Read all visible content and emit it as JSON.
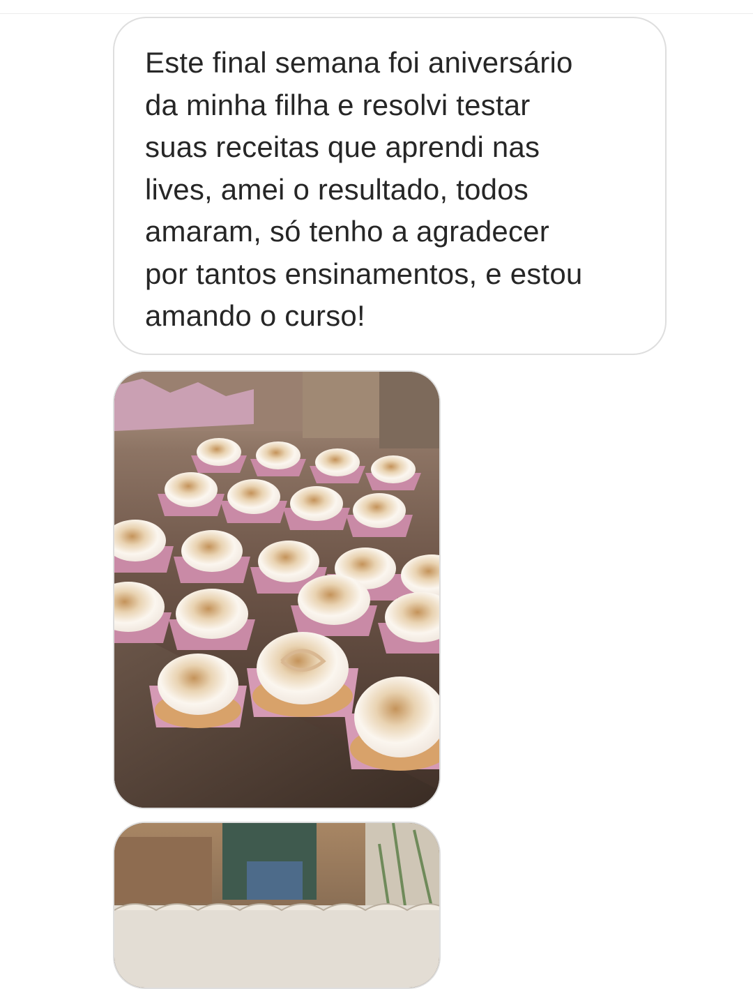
{
  "thread": {
    "messages": [
      {
        "type": "text",
        "text": "Este final semana foi aniversário\nda minha filha e resolvi testar\nsuas receitas que aprendi nas\nlives, amei o resultado, todos\namaram, só tenho a agradecer\npor tantos ensinamentos, e estou\namando o curso!"
      },
      {
        "type": "image",
        "subject": "meringue-tartlets-in-pink-wrappers"
      },
      {
        "type": "image",
        "subject": "party-table-with-sweets"
      }
    ]
  },
  "colors": {
    "background": "#ffffff",
    "bubble_border": "#dedede",
    "text": "#262626",
    "wrapper_pink": "#c98aa6",
    "meringue": "#fbf6ef",
    "toasted": "#c79a5d",
    "tray": "#5a4538"
  }
}
